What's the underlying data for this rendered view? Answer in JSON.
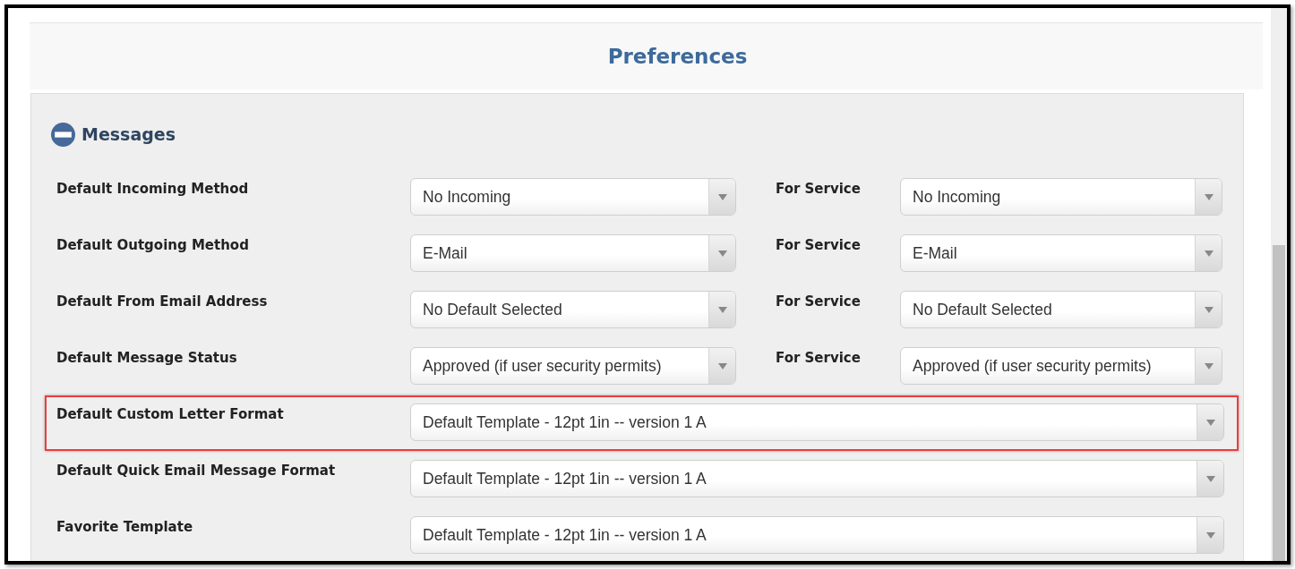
{
  "header": {
    "title": "Preferences"
  },
  "section": {
    "title": "Messages",
    "expanded": true
  },
  "rows": [
    {
      "label": "Default Incoming Method",
      "value": "No Incoming",
      "highlighted": false,
      "service": {
        "label": "For Service",
        "value": "No Incoming"
      }
    },
    {
      "label": "Default Outgoing Method",
      "value": "E-Mail",
      "highlighted": false,
      "service": {
        "label": "For Service",
        "value": "E-Mail"
      }
    },
    {
      "label": "Default From Email Address",
      "value": "No Default Selected",
      "highlighted": false,
      "service": {
        "label": "For Service",
        "value": "No Default Selected"
      }
    },
    {
      "label": "Default Message Status",
      "value": "Approved (if user security permits)",
      "highlighted": false,
      "service": {
        "label": "For Service",
        "value": "Approved (if user security permits)"
      }
    },
    {
      "label": "Default Custom Letter Format",
      "value": "Default Template - 12pt 1in -- version 1 A",
      "highlighted": true
    },
    {
      "label": "Default Quick Email Message Format",
      "value": "Default Template - 12pt 1in -- version 1 A",
      "highlighted": false
    },
    {
      "label": "Favorite Template",
      "value": "Default Template - 12pt 1in -- version 1 A",
      "highlighted": false
    }
  ]
}
